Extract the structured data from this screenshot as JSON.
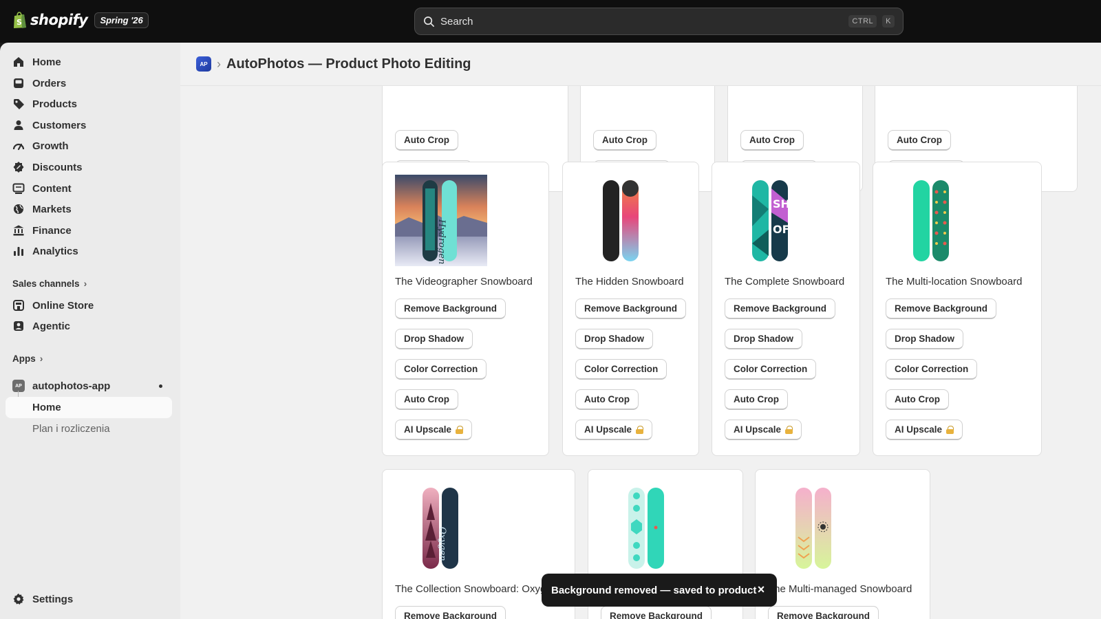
{
  "topbar": {
    "brand": "shopify",
    "edition": "Spring '26",
    "search_placeholder": "Search",
    "shortcut_ctrl": "CTRL",
    "shortcut_key": "K"
  },
  "sidebar": {
    "items": [
      {
        "label": "Home",
        "icon": "home-icon"
      },
      {
        "label": "Orders",
        "icon": "orders-icon"
      },
      {
        "label": "Products",
        "icon": "tag-icon"
      },
      {
        "label": "Customers",
        "icon": "person-icon"
      },
      {
        "label": "Growth",
        "icon": "growth-icon"
      },
      {
        "label": "Discounts",
        "icon": "discount-icon"
      },
      {
        "label": "Content",
        "icon": "content-icon"
      },
      {
        "label": "Markets",
        "icon": "globe-icon"
      },
      {
        "label": "Finance",
        "icon": "bank-icon"
      },
      {
        "label": "Analytics",
        "icon": "bar-chart-icon"
      }
    ],
    "sales_channels_label": "Sales channels",
    "channels": [
      {
        "label": "Online Store",
        "icon": "store-icon"
      },
      {
        "label": "Agentic",
        "icon": "agentic-icon"
      }
    ],
    "apps_label": "Apps",
    "app_name": "autophotos-app",
    "app_badge": "AP",
    "app_sub_items": [
      "Home",
      "Plan i rozliczenia"
    ],
    "settings_label": "Settings"
  },
  "header": {
    "badge": "AP",
    "title": "AutoPhotos — Product Photo Editing"
  },
  "actions": {
    "remove_bg": "Remove Background",
    "drop_shadow": "Drop Shadow",
    "color_correction": "Color Correction",
    "auto_crop": "Auto Crop",
    "ai_upscale": "AI Upscale"
  },
  "products": [
    "The Videographer Snowboard",
    "The Hidden Snowboard",
    "The Complete Snowboard",
    "The Multi-location Snowboard",
    "The Collection Snowboard: Oxygen",
    "",
    "The Multi-managed Snowboard"
  ],
  "toast": {
    "message": "Background removed — saved to product"
  }
}
